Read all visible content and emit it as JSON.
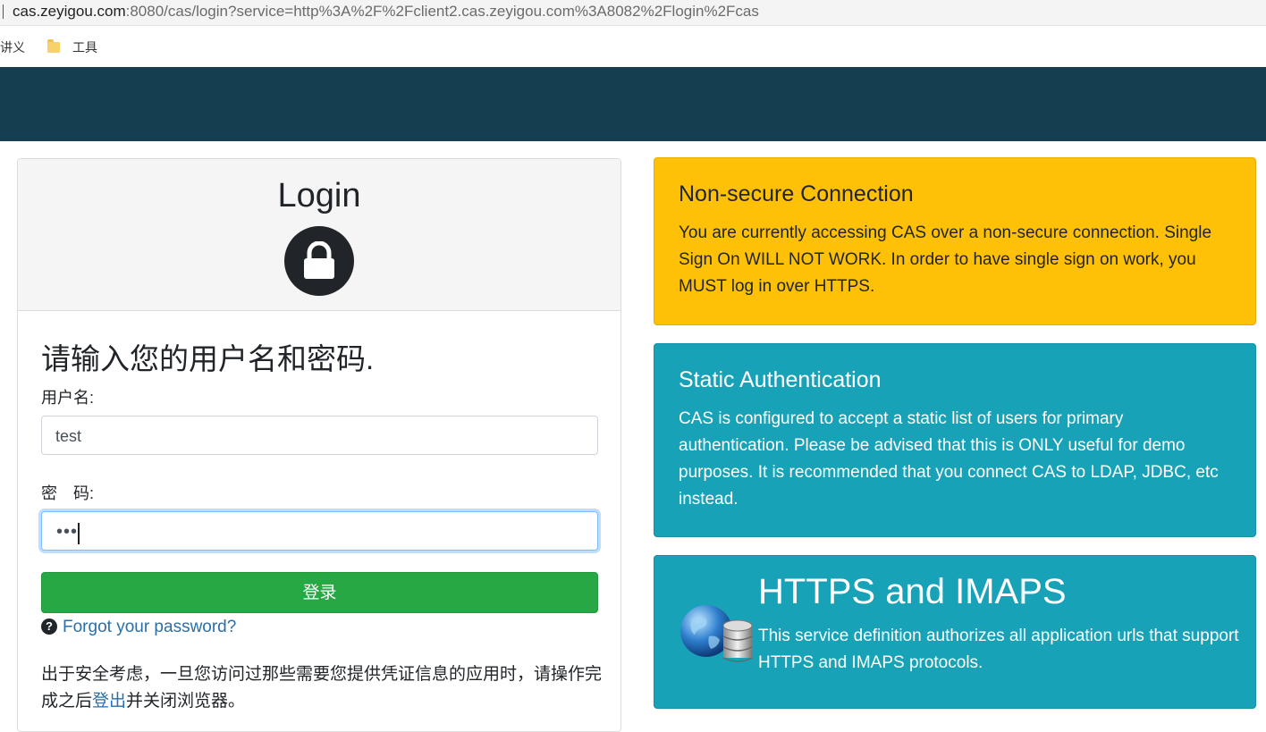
{
  "browser": {
    "url_host": "cas.zeyigou.com",
    "url_rest": ":8080/cas/login?service=http%3A%2F%2Fclient2.cas.zeyigou.com%3A8082%2Flogin%2Fcas",
    "bookmarks": [
      "讲义",
      "工具"
    ]
  },
  "login": {
    "title": "Login",
    "prompt": "请输入您的用户名和密码.",
    "username_label": "用户名:",
    "username_value": "test",
    "password_label": "密　码:",
    "password_value": "•••",
    "submit_label": "登录",
    "forgot_label": "Forgot your password?",
    "security_note_before": "出于安全考虑，一旦您访问过那些需要您提供凭证信息的应用时，请操作完成之后",
    "security_note_link": "登出",
    "security_note_after": "并关闭浏览器。"
  },
  "notices": {
    "nonsecure": {
      "title": "Non-secure Connection",
      "body": "You are currently accessing CAS over a non-secure connection. Single Sign On WILL NOT WORK. In order to have single sign on work, you MUST log in over HTTPS."
    },
    "static_auth": {
      "title": "Static Authentication",
      "body": "CAS is configured to accept a static list of users for primary authentication. Please be advised that this is ONLY useful for demo purposes. It is recommended that you connect CAS to LDAP, JDBC, etc instead."
    },
    "https": {
      "title": "HTTPS and IMAPS",
      "body": "This service definition authorizes all application urls that support HTTPS and IMAPS protocols."
    }
  },
  "colors": {
    "header_bar": "#153e50",
    "warning": "#ffc107",
    "info": "#17a2b8",
    "success": "#28a745"
  },
  "icons": [
    "lock-icon",
    "question-circle-icon",
    "globe-database-icon",
    "folder-icon"
  ]
}
